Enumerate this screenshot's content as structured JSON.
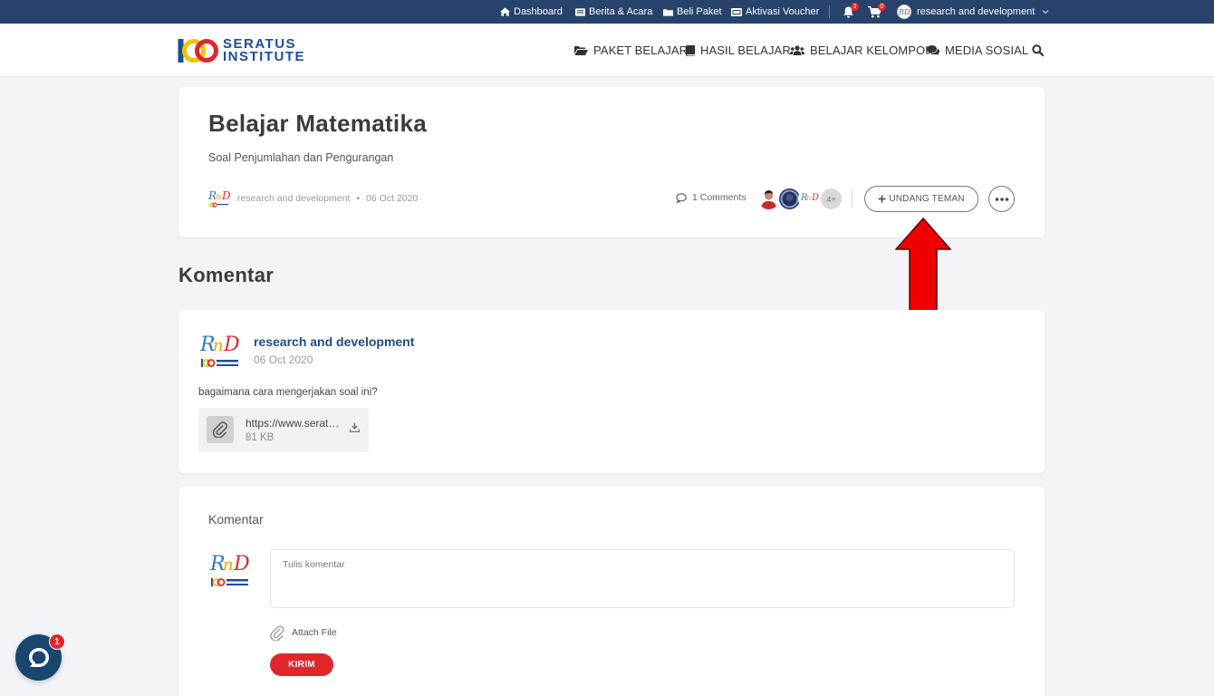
{
  "topbar": {
    "items": [
      {
        "label": "Dashboard",
        "icon": "home-icon"
      },
      {
        "label": "Berita & Acara",
        "icon": "newspaper-icon"
      },
      {
        "label": "Beli Paket",
        "icon": "folder-icon"
      },
      {
        "label": "Aktivasi Voucher",
        "icon": "ticket-icon"
      }
    ],
    "notifications_count": "2",
    "cart_count": "0",
    "user_name": "research and development"
  },
  "logo": {
    "line1": "SERATUS",
    "line2": "INSTITUTE"
  },
  "nav": {
    "items": [
      {
        "label": "PAKET BELAJAR",
        "icon": "folder-open-icon"
      },
      {
        "label": "HASIL BELAJAR",
        "icon": "book-icon"
      },
      {
        "label": "BELAJAR KELOMPOK",
        "icon": "users-icon"
      },
      {
        "label": "MEDIA SOSIAL",
        "icon": "comments-icon"
      }
    ]
  },
  "post": {
    "title": "Belajar Matematika",
    "subtitle": "Soal Penjumlahan dan Pengurangan",
    "author": "research and development",
    "separator": "•",
    "date": "06 Oct 2020",
    "comments_label": "1 Comments",
    "more_members": "4+",
    "invite_label": "UNDANG TEMAN"
  },
  "comments_section": {
    "title": "Komentar",
    "comments": [
      {
        "author": "research and development",
        "date": "06 Oct 2020",
        "text": "bagaimana cara mengerjakan soal ini?",
        "attachment": {
          "name": "https://www.seratusinstitute.com/file",
          "size": "81 KB"
        }
      }
    ]
  },
  "comment_form": {
    "title": "Komentar",
    "placeholder": "Tulis komentar",
    "attach_label": "Attach File",
    "submit_label": "KIRIM"
  },
  "chat": {
    "badge": "1"
  },
  "colors": {
    "topbar": "#27426b",
    "accent": "#e0262b",
    "link": "#1f4a86"
  }
}
